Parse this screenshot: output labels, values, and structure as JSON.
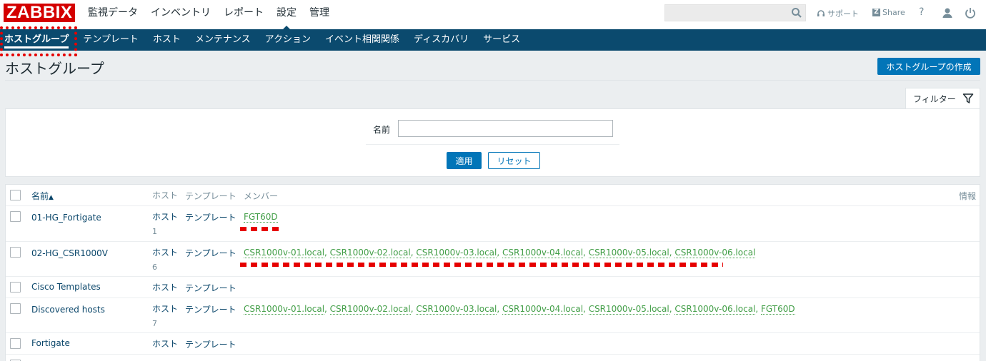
{
  "app": {
    "logo": "ZABBIX",
    "main_menu": [
      "監視データ",
      "インベントリ",
      "レポート",
      "設定",
      "管理"
    ],
    "active_main": "設定",
    "support_label": "サポート",
    "share_label": "Share",
    "help_label": "?"
  },
  "sub_menu": [
    "ホストグループ",
    "テンプレート",
    "ホスト",
    "メンテナンス",
    "アクション",
    "イベント相関関係",
    "ディスカバリ",
    "サービス"
  ],
  "page": {
    "title": "ホストグループ",
    "create_button": "ホストグループの作成"
  },
  "filter": {
    "tab_label": "フィルター",
    "name_label": "名前",
    "name_value": "",
    "apply_label": "適用",
    "reset_label": "リセット"
  },
  "table": {
    "headers": {
      "name": "名前",
      "sort_indicator": "▲",
      "hosts": "ホスト",
      "templates": "テンプレート",
      "members": "メンバー",
      "info": "情報"
    },
    "rows": [
      {
        "name": "01-HG_Fortigate",
        "hosts_label": "ホスト",
        "hosts_count": "1",
        "templates_label": "テンプレート",
        "members": [
          "FGT60D"
        ]
      },
      {
        "name": "02-HG_CSR1000V",
        "hosts_label": "ホスト",
        "hosts_count": "6",
        "templates_label": "テンプレート",
        "members": [
          "CSR1000v-01.local",
          "CSR1000v-02.local",
          "CSR1000v-03.local",
          "CSR1000v-04.local",
          "CSR1000v-05.local",
          "CSR1000v-06.local"
        ]
      },
      {
        "name": "Cisco Templates",
        "hosts_label": "ホスト",
        "hosts_count": "",
        "templates_label": "テンプレート",
        "members": []
      },
      {
        "name": "Discovered hosts",
        "hosts_label": "ホスト",
        "hosts_count": "7",
        "templates_label": "テンプレート",
        "members": [
          "CSR1000v-01.local",
          "CSR1000v-02.local",
          "CSR1000v-03.local",
          "CSR1000v-04.local",
          "CSR1000v-05.local",
          "CSR1000v-06.local",
          "FGT60D"
        ]
      },
      {
        "name": "Fortigate",
        "hosts_label": "ホスト",
        "hosts_count": "",
        "templates_label": "テンプレート",
        "members": []
      }
    ]
  },
  "colors": {
    "brand_red": "#d40000",
    "nav_blue": "#0b4a6e",
    "button_blue": "#0275b8",
    "member_green": "#429e47",
    "annotation_red": "#e60000"
  }
}
